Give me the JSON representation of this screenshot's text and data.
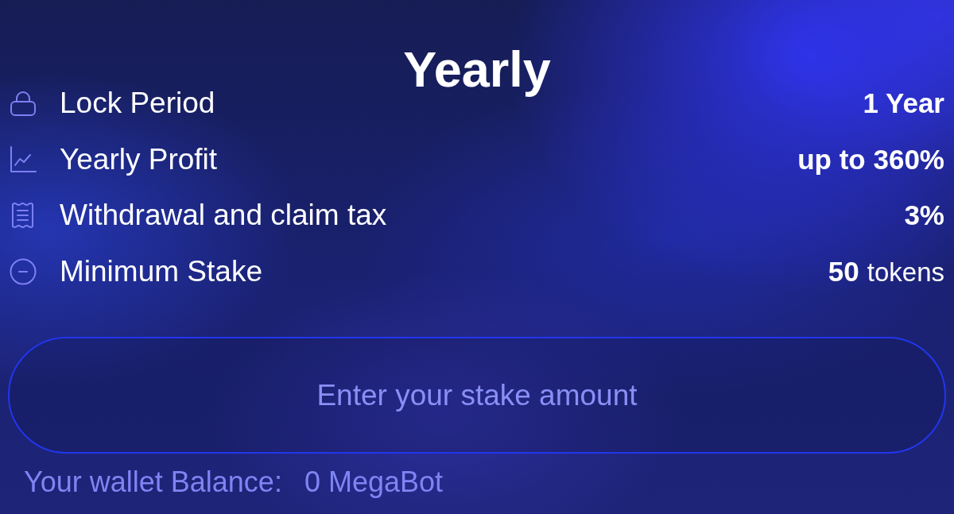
{
  "title": "Yearly",
  "details": [
    {
      "kind": "period",
      "label": "Lock Period",
      "value": "1 Year"
    },
    {
      "kind": "profit",
      "label": "Yearly Profit",
      "value": "up to 360%"
    },
    {
      "kind": "tax",
      "label": "Withdrawal and claim tax",
      "value": "3%"
    },
    {
      "kind": "minimum",
      "label": "Minimum Stake",
      "value": "50",
      "unit": "tokens"
    }
  ],
  "stake_field": {
    "placeholder": "Enter your stake amount"
  },
  "wallet_balance": {
    "label": "Your wallet Balance:",
    "value": "0 MegaBot"
  }
}
